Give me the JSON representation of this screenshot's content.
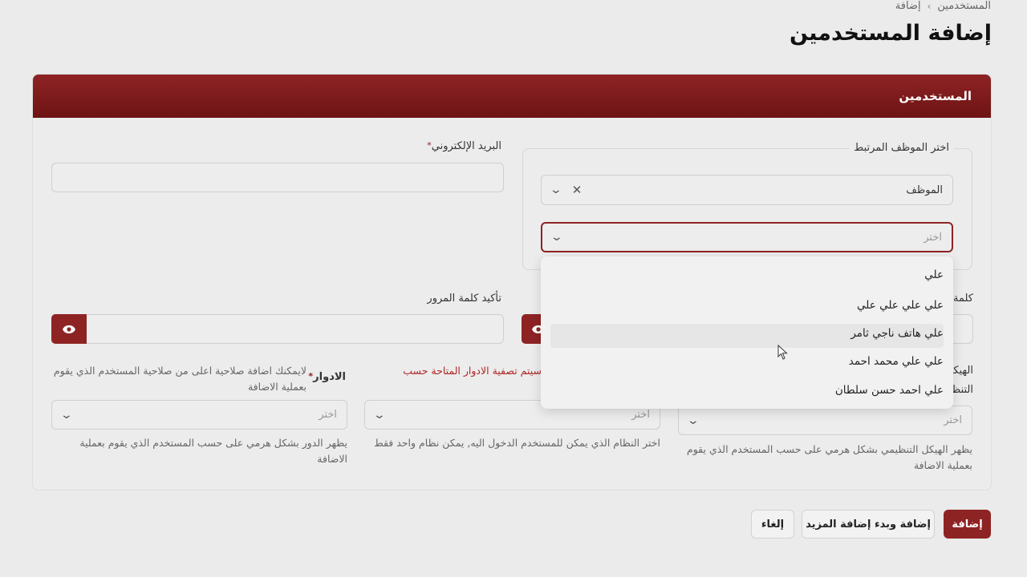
{
  "breadcrumb": {
    "parent": "المستخدمين",
    "separator": "›",
    "current": "إضافة"
  },
  "page_title": "إضافة المستخدمين",
  "card": {
    "header": "المستخدمين"
  },
  "linked_employee": {
    "legend": "اختر الموظف المرتبط",
    "type_select_value": "الموظف",
    "employee_select_placeholder": "اختر",
    "dropdown_options": [
      "علي",
      "علي علي علي علي",
      "علي هاتف ناجي ثامر",
      "علي علي محمد احمد",
      "علي احمد حسن سلطان"
    ]
  },
  "email": {
    "label": "البريد الإلكتروني",
    "required_mark": "*",
    "value": ""
  },
  "password": {
    "label_partial": "كلمة",
    "value": ""
  },
  "confirm_password": {
    "label": "تأكيد كلمة المرور",
    "value": ""
  },
  "org_structure": {
    "label_line1": "الهيكل",
    "label_line2": "التنظ",
    "placeholder": "اختر",
    "help": "يظهر الهيكل التنظيمي بشكل هرمي على حسب المستخدم الذي يقوم بعملية الاضافة"
  },
  "systems": {
    "warning": "سيتم تصفية الادوار المتاحة حسب",
    "placeholder": "اختر",
    "help": "اختر النظام الذي يمكن للمستخدم الدخول اليه, يمكن نظام واحد فقط"
  },
  "roles": {
    "label": "الادوار",
    "required_mark": "*",
    "note": "لايمكنك اضافة صلاحية اعلى من صلاحية المستخدم الذي يقوم بعملية الاضافة",
    "placeholder": "اختر",
    "help": "يظهر الدور بشكل هرمي على حسب المستخدم الذي يقوم بعملية الاضافة"
  },
  "buttons": {
    "add": "إضافة",
    "add_more": "إضافة وبدء إضافة المزيد",
    "cancel": "إلغاء"
  },
  "icons": {
    "eye": "eye-icon",
    "chevron": "chevron-down-icon",
    "clear": "close-icon",
    "cursor": "mouse-cursor"
  },
  "colors": {
    "primary": "#8e2324",
    "warning": "#b02525"
  }
}
